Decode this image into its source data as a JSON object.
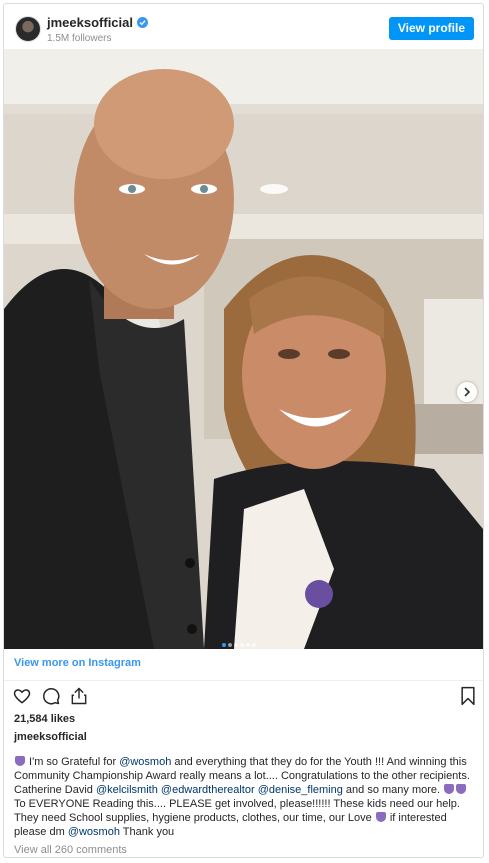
{
  "header": {
    "username": "jmeeksofficial",
    "followers": "1.5M followers",
    "view_profile_label": "View profile"
  },
  "carousel": {
    "slide_count": 6,
    "active_index": 0
  },
  "view_more_label": "View more on Instagram",
  "likes": "21,584 likes",
  "caption": {
    "username": "jmeeksofficial",
    "segments": [
      {
        "t": "emoji",
        "v": "pray"
      },
      {
        "t": "text",
        "v": " I'm so Grateful for "
      },
      {
        "t": "mention",
        "v": "@wosmoh"
      },
      {
        "t": "text",
        "v": " and everything that they do for the Youth !!! And winning this Community Championship Award really means a lot.... Congratulations to the other recipients. Catherine David "
      },
      {
        "t": "mention",
        "v": "@kelcilsmith"
      },
      {
        "t": "text",
        "v": " "
      },
      {
        "t": "mention",
        "v": "@edwardtherealtor"
      },
      {
        "t": "text",
        "v": " "
      },
      {
        "t": "mention",
        "v": "@denise_fleming"
      },
      {
        "t": "text",
        "v": " and so many more. "
      },
      {
        "t": "emoji",
        "v": "pray"
      },
      {
        "t": "emoji",
        "v": "pray"
      },
      {
        "t": "text",
        "v": " To EVERYONE Reading this.... PLEASE get involved, please!!!!!! These kids need our help. They need School supplies, hygiene products, clothes, our time, our Love "
      },
      {
        "t": "emoji",
        "v": "pray"
      },
      {
        "t": "text",
        "v": " if interested please dm "
      },
      {
        "t": "mention",
        "v": "@wosmoh"
      },
      {
        "t": "text",
        "v": " Thank you"
      }
    ]
  },
  "comments_label": "View all 260 comments",
  "icons": [
    "heart-icon",
    "comment-icon",
    "share-icon",
    "bookmark-icon",
    "verified-badge-icon",
    "chevron-right-icon"
  ],
  "colors": {
    "link": "#3897f0",
    "button": "#0095f6",
    "mention": "#00376b"
  }
}
